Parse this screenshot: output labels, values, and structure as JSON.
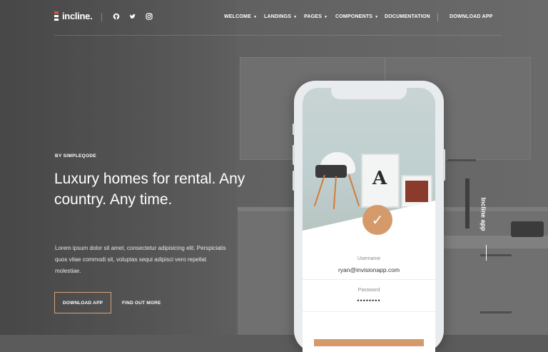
{
  "nav": {
    "logo_text": "incline.",
    "social_icons": [
      "github-icon",
      "twitter-icon",
      "instagram-icon"
    ],
    "menu": [
      {
        "label": "WELCOME",
        "has_dropdown": true
      },
      {
        "label": "LANDINGS",
        "has_dropdown": true
      },
      {
        "label": "PAGES",
        "has_dropdown": true
      },
      {
        "label": "COMPONENTS",
        "has_dropdown": true
      },
      {
        "label": "DOCUMENTATION",
        "has_dropdown": false
      }
    ],
    "download_label": "DOWNLOAD APP"
  },
  "hero": {
    "eyebrow": "BY SIMPLEQODE",
    "headline": "Luxury homes for rental. Any country. Any time.",
    "lead": "Lorem ipsum dolor sit amet, consectetur adipisicing elit. Perspiciatis quos vitae commodi sit, voluptas sequi adipisci vero repellat molestiae.",
    "primary_button": "DOWNLOAD APP",
    "secondary_button": "FIND OUT MORE"
  },
  "phone": {
    "username_label": "Username",
    "username_value": "ryan@invisionapp.com",
    "password_label": "Password",
    "password_value": "••••••••"
  },
  "side_label": "Incline app",
  "colors": {
    "accent": "#d59a6a",
    "logo_red": "#e0563a"
  }
}
